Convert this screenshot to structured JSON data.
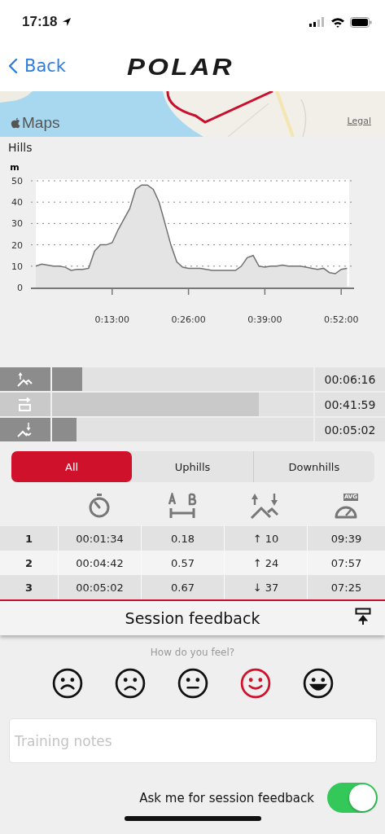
{
  "status_bar": {
    "time": "17:18"
  },
  "nav": {
    "back": "Back",
    "logo": "POLAR"
  },
  "map": {
    "brand": "Maps",
    "legal": "Legal"
  },
  "hills": {
    "title": "Hills",
    "chart_data": {
      "type": "area",
      "ylabel": "m",
      "x": [
        0,
        1,
        2,
        3,
        4,
        5,
        6,
        7,
        8,
        9,
        10,
        11,
        12,
        13,
        14,
        15,
        16,
        17,
        18,
        19,
        20,
        21,
        22,
        23,
        24,
        25,
        26,
        27,
        28,
        29,
        30,
        31,
        32,
        33,
        34,
        35,
        36,
        37,
        38,
        39,
        40,
        41,
        42,
        43,
        44,
        45,
        46,
        47,
        48,
        49,
        50,
        51,
        52,
        53
      ],
      "grid": true,
      "series": [
        {
          "color": "#707070",
          "values": [
            10,
            11,
            10.5,
            10,
            10,
            9.5,
            8,
            8.5,
            8.5,
            9,
            17,
            20,
            20,
            21,
            27,
            32,
            37,
            46,
            48,
            48,
            46,
            40,
            30,
            20,
            12,
            9.5,
            9,
            9,
            9,
            8.5,
            8,
            8,
            8,
            8,
            8,
            10,
            14,
            15,
            10,
            9.5,
            10,
            10,
            10.5,
            10,
            10,
            10,
            9.5,
            9,
            8.5,
            9,
            7,
            6.5,
            8.5,
            9
          ]
        }
      ],
      "xlim": [
        0,
        53.5
      ],
      "ylim": [
        0,
        50
      ],
      "yticks": [
        0,
        10,
        20,
        30,
        40,
        50
      ],
      "xticks": [
        {
          "value": 13,
          "label": "0:13:00"
        },
        {
          "value": 26,
          "label": "0:26:00"
        },
        {
          "value": 39,
          "label": "0:39:00"
        },
        {
          "value": 52,
          "label": "0:52:00"
        }
      ]
    }
  },
  "hill_bars": [
    {
      "kind": "uphill",
      "level": 0.115,
      "time": "00:06:16"
    },
    {
      "kind": "flat",
      "level": 0.79,
      "time": "00:41:59"
    },
    {
      "kind": "downhill",
      "level": 0.093,
      "time": "00:05:02"
    }
  ],
  "filter_tabs": [
    {
      "label": "All",
      "selected": true
    },
    {
      "label": "Uphills",
      "selected": false
    },
    {
      "label": "Downhills",
      "selected": false
    }
  ],
  "table": {
    "avg_badge": "AVG",
    "rows": [
      {
        "number": "1",
        "duration": "00:01:34",
        "distance": "0.18",
        "climb": "↑ 10",
        "pace": "09:39"
      },
      {
        "number": "2",
        "duration": "00:04:42",
        "distance": "0.57",
        "climb": "↑ 24",
        "pace": "07:57"
      },
      {
        "number": "3",
        "duration": "00:05:02",
        "distance": "0.67",
        "climb": "↓ 37",
        "pace": "07:25"
      }
    ]
  },
  "feedback": {
    "title": "Session feedback",
    "question": "How do you feel?",
    "moods": [
      {
        "kind": "very-sad",
        "selected": false
      },
      {
        "kind": "sad",
        "selected": false
      },
      {
        "kind": "neutral",
        "selected": false
      },
      {
        "kind": "happy",
        "selected": true
      },
      {
        "kind": "very-happy",
        "selected": false
      }
    ],
    "notes_placeholder": "Training notes",
    "ask_label": "Ask me for session feedback",
    "ask_on": true
  }
}
